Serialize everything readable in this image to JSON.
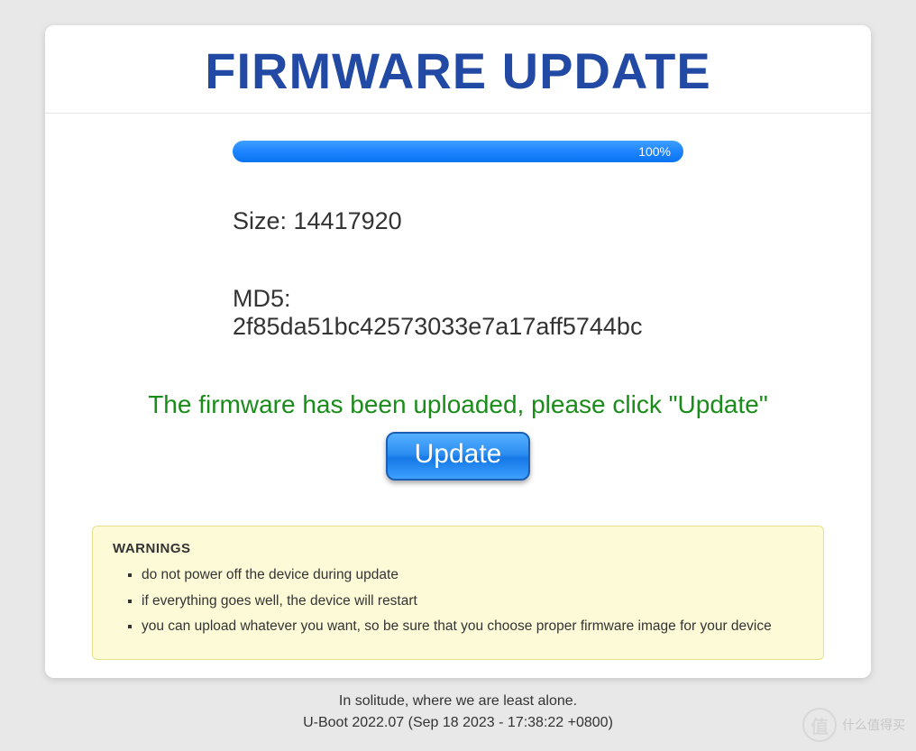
{
  "title": "FIRMWARE UPDATE",
  "progress": {
    "percent_label": "100%"
  },
  "info": {
    "size_label": "Size: 14417920",
    "md5_label": "MD5: 2f85da51bc42573033e7a17aff5744bc"
  },
  "success_message": "The firmware has been uploaded, please click \"Update\"",
  "update_button_label": "Update",
  "warnings": {
    "heading": "WARNINGS",
    "items": [
      "do not power off the device during update",
      "if everything goes well, the device will restart",
      "you can upload whatever you want, so be sure that you choose proper firmware image for your device"
    ]
  },
  "footer": {
    "quote": "In solitude, where we are least alone.",
    "version": "U-Boot 2022.07 (Sep 18 2023 - 17:38:22 +0800)"
  },
  "watermark": {
    "symbol": "值",
    "text": "什么值得买"
  }
}
